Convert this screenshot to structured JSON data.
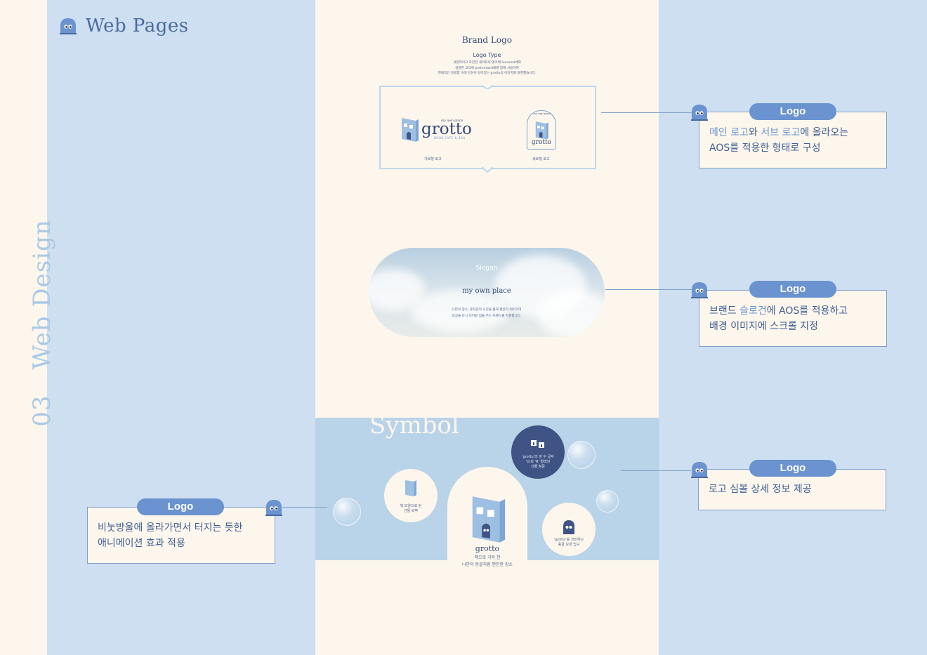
{
  "page": {
    "header_title": "Web Pages",
    "side_number": "03",
    "side_title": "Web Design"
  },
  "brand_logo": {
    "title": "Brand Logo",
    "subtitle": "Logo Type",
    "desc_lines": [
      "서정적이고 모던한 세리프의 명조체 Suranna체와",
      "정갈한 고딕체 pretendard체를 함께 사용하여",
      "현대적인 정갈함 속에 감성이 살아있는 grotto의 이미지를 표현했습니다."
    ],
    "main_logo": {
      "top": "my own place",
      "word": "grotto",
      "sub": "BOOK CAFE & BAR",
      "caption": "가로형 로고"
    },
    "sub_logo": {
      "top": "my own place",
      "word": "grotto",
      "caption": "세로형 로고"
    }
  },
  "slogan": {
    "label": "Slogan",
    "main": "my own place",
    "desc_lines": [
      "나만의 장소, 혼자만의 시간을 통해 편안히 쉬어가며",
      "일상을 다시 이어갈 힘을 주는 브랜드를 지향합니다."
    ]
  },
  "symbol": {
    "title": "Symbol",
    "dark_circle_lines": [
      "'grotto'의 앞 두 글자",
      "'G'와 'R' 형태의",
      "건물 창문"
    ],
    "left_circle_lines": [
      "책 모양으로 된",
      "건물 외벽"
    ],
    "right_circle_lines": [
      "'grotto'를 의미하는",
      "동굴 모양 입구"
    ],
    "center_word": "grotto",
    "center_desc_lines": [
      "책으로 가득 찬",
      "나만의 동굴처럼 편안한 장소"
    ]
  },
  "callouts": [
    {
      "label": "Logo",
      "line1_parts": [
        "메인 로고",
        "와 ",
        "서브 로고",
        "에 올라오는"
      ],
      "line2": "AOS를 적용한 형태로 구성"
    },
    {
      "label": "Logo",
      "line1_parts": [
        "브랜드 ",
        "슬로건",
        "에 AOS를 적용하고"
      ],
      "line2": "배경 이미지에 스크롤 지정"
    },
    {
      "label": "Logo",
      "line1": "로고 심볼 상세 정보 제공"
    },
    {
      "label": "Logo",
      "line1": "비눗방울에 올라가면서 터지는 듯한",
      "line2": "애니메이션 효과 적용"
    }
  ],
  "colors": {
    "panel_blue": "#cddff0",
    "cream": "#fdf6ec",
    "accent": "#6a93cf",
    "navy": "#34497a"
  },
  "icons": [
    "ghost-icon",
    "book-building-icon"
  ]
}
